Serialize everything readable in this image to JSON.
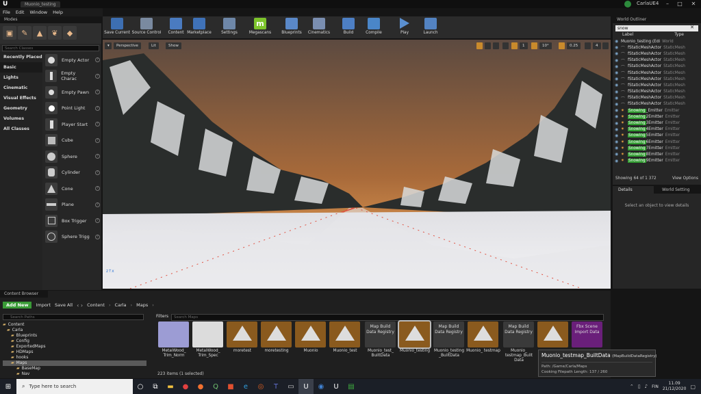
{
  "window": {
    "tab_title": "Muonio_testing",
    "profile": "CarlaUE4"
  },
  "menu": [
    "File",
    "Edit",
    "Window",
    "Help"
  ],
  "modes": {
    "tab": "Modes",
    "search_placeholder": "Search Classes",
    "categories": [
      "Recently Placed",
      "Basic",
      "Lights",
      "Cinematic",
      "Visual Effects",
      "Geometry",
      "Volumes",
      "All Classes"
    ],
    "items": [
      "Empty Actor",
      "Empty Charac",
      "Empty Pawn",
      "Point Light",
      "Player Start",
      "Cube",
      "Sphere",
      "Cylinder",
      "Cone",
      "Plane",
      "Box Trigger",
      "Sphere Trigg"
    ]
  },
  "toolbar": [
    "Save Current",
    "Source Control",
    "Content",
    "Marketplace",
    "Settings",
    "Megascans",
    "Blueprints",
    "Cinematics",
    "Build",
    "Compile",
    "Play",
    "Launch"
  ],
  "viewport": {
    "perspective": "Perspective",
    "lit": "Lit",
    "show": "Show",
    "snap_angle": "10°",
    "scale": "0.25",
    "speed": "4",
    "grid": "1"
  },
  "outliner": {
    "tab": "World Outliner",
    "search": "snow",
    "col_label": "Label",
    "col_type": "Type",
    "root": {
      "name": "Muonio_testing (Edi",
      "type": "World"
    },
    "actors": [
      {
        "name": "fStaticMeshActor",
        "type": "StaticMesh"
      },
      {
        "name": "fStaticMeshActor",
        "type": "StaticMesh"
      },
      {
        "name": "fStaticMeshActor",
        "type": "StaticMesh"
      },
      {
        "name": "fStaticMeshActor",
        "type": "StaticMesh"
      },
      {
        "name": "fStaticMeshActor",
        "type": "StaticMesh"
      },
      {
        "name": "fStaticMeshActor",
        "type": "StaticMesh"
      },
      {
        "name": "fStaticMeshActor",
        "type": "StaticMesh"
      },
      {
        "name": "fStaticMeshActor",
        "type": "StaticMesh"
      },
      {
        "name": "fStaticMeshActor",
        "type": "StaticMesh"
      },
      {
        "name": "fStaticMeshActor",
        "type": "StaticMesh"
      }
    ],
    "emitters": [
      {
        "hl": "Snowing",
        "rest": "_Emitter",
        "type": "Emitter"
      },
      {
        "hl": "Snowing",
        "rest": "2Emitter",
        "type": "Emitter"
      },
      {
        "hl": "Snowing",
        "rest": "3Emitter",
        "type": "Emitter"
      },
      {
        "hl": "Snowing",
        "rest": "4Emitter",
        "type": "Emitter"
      },
      {
        "hl": "Snowing",
        "rest": "5Emitter",
        "type": "Emitter"
      },
      {
        "hl": "Snowing",
        "rest": "6Emitter",
        "type": "Emitter"
      },
      {
        "hl": "Snowing",
        "rest": "7Emitter",
        "type": "Emitter"
      },
      {
        "hl": "Snowing",
        "rest": "8Emitter",
        "type": "Emitter"
      },
      {
        "hl": "Snowing",
        "rest": "9Emitter",
        "type": "Emitter"
      }
    ],
    "count": "Showing 64 of 1 372",
    "view_options": "View Options"
  },
  "details": {
    "tab1": "Details",
    "tab2": "World Setting",
    "empty": "Select an object to view details"
  },
  "content_browser": {
    "tab": "Content Browser",
    "add_new": "Add New",
    "import": "Import",
    "save_all": "Save All",
    "path": [
      "Content",
      "Carla",
      "Maps"
    ],
    "search_paths": "Search Paths",
    "filters": "Filters",
    "search_maps": "Search Maps",
    "tree": [
      "Content",
      "Carla",
      "Blueprints",
      "Config",
      "ExportedMaps",
      "HDMaps",
      "hooks",
      "Maps",
      "BaseMap",
      "Nav"
    ],
    "assets": [
      {
        "label": "MetalWood_ Trim_Norm"
      },
      {
        "label": "MetalWood_ Trim_Spec"
      },
      {
        "label": "moretest"
      },
      {
        "label": "moretesting"
      },
      {
        "label": "Muonio"
      },
      {
        "label": "Muonio_test"
      },
      {
        "label": "Muonio_test_ BuiltData",
        "thumb": "Map Build Data Registry"
      },
      {
        "label": "Muonio_testing"
      },
      {
        "label": "Muonio_testing _BuiltData",
        "thumb": "Map Build Data Registry"
      },
      {
        "label": "Muonio_ testmap"
      },
      {
        "label": "Muonio_ testmap_Built Data",
        "thumb": "Map Build Data Registry"
      },
      {
        "label": ""
      },
      {
        "label": "",
        "thumb": "Fbx Scene Import Data"
      }
    ],
    "status": "223 items (1 selected)"
  },
  "tooltip": {
    "title": "Muonio_testmap_BuiltData",
    "subtitle": "(MapBuildDataRegistry)",
    "path": "Path: /Game/Carla/Maps",
    "cooking": "Cooking Filepath Length: 137 / 260"
  },
  "taskbar": {
    "search_placeholder": "Type here to search",
    "time": "11.09",
    "date": "21/12/2020",
    "lang": "FIN"
  }
}
